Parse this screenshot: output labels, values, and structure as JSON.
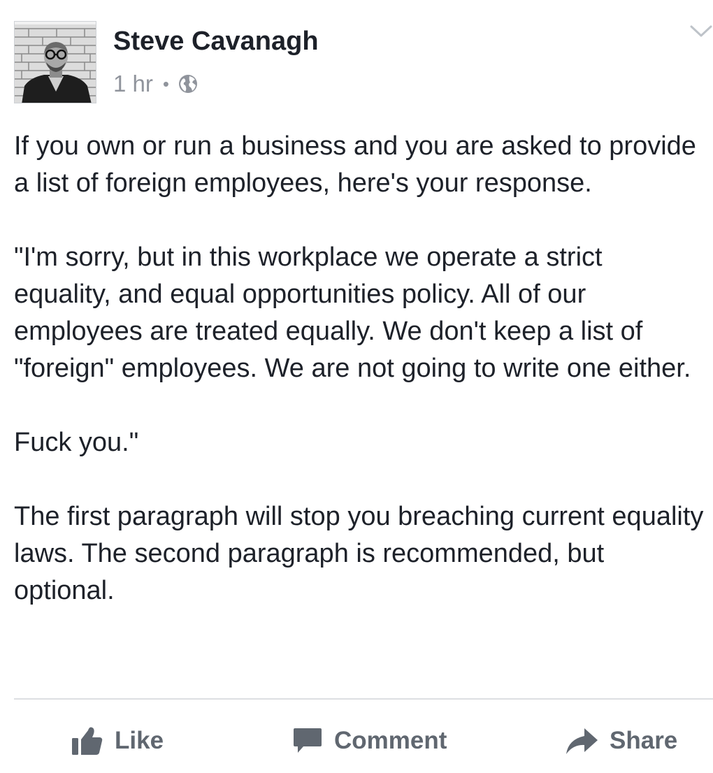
{
  "post": {
    "author": "Steve Cavanagh",
    "timestamp": "1 hr",
    "separator": "•",
    "privacy_icon": "globe-icon",
    "menu_icon": "chevron-down-icon",
    "paragraphs": [
      "If you own or run a business and you are asked to provide a list of foreign employees, here's your response.",
      "\"I'm sorry, but in this workplace we operate a strict equality, and equal opportunities policy. All of our employees are treated equally. We don't keep a list of \"foreign\" employees. We are not going to write one either.",
      "Fuck you.\"",
      "The first paragraph will stop you breaching current equality laws. The second paragraph is recommended, but optional."
    ]
  },
  "actions": {
    "like_label": "Like",
    "like_icon": "thumbs-up-icon",
    "comment_label": "Comment",
    "comment_icon": "speech-bubble-icon",
    "share_label": "Share",
    "share_icon": "share-arrow-icon"
  },
  "colors": {
    "text_primary": "#1d2129",
    "text_secondary": "#90949c",
    "action_text": "#606770",
    "divider": "#dddfe2"
  }
}
